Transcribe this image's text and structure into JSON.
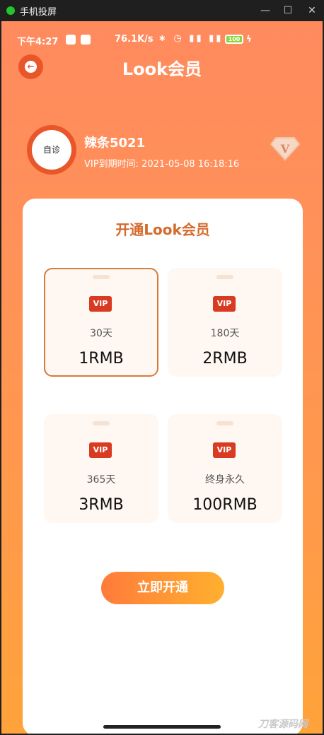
{
  "window": {
    "title": "手机投屏",
    "controls": {
      "minimize": "—",
      "maximize": "☐",
      "close": "✕"
    }
  },
  "statusbar": {
    "time": "下午4:27",
    "speed": "76.1K/s",
    "battery": "100"
  },
  "header": {
    "title": "Look会员"
  },
  "profile": {
    "avatar_text": "自诊",
    "username": "辣条5021",
    "expiry": "VIP到期时间: 2021-05-08 16:18:16"
  },
  "card": {
    "title": "开通Look会员",
    "plans": [
      {
        "badge": "VIP",
        "days": "30天",
        "price": "1RMB",
        "selected": true
      },
      {
        "badge": "VIP",
        "days": "180天",
        "price": "2RMB",
        "selected": false
      },
      {
        "badge": "VIP",
        "days": "365天",
        "price": "3RMB",
        "selected": false
      },
      {
        "badge": "VIP",
        "days": "终身永久",
        "price": "100RMB",
        "selected": false
      }
    ],
    "cta": "立即开通"
  },
  "watermark": "刀客源码网",
  "colors": {
    "accent": "#e9562a",
    "title_orange": "#d66a2c",
    "vip_red": "#d93a22"
  }
}
